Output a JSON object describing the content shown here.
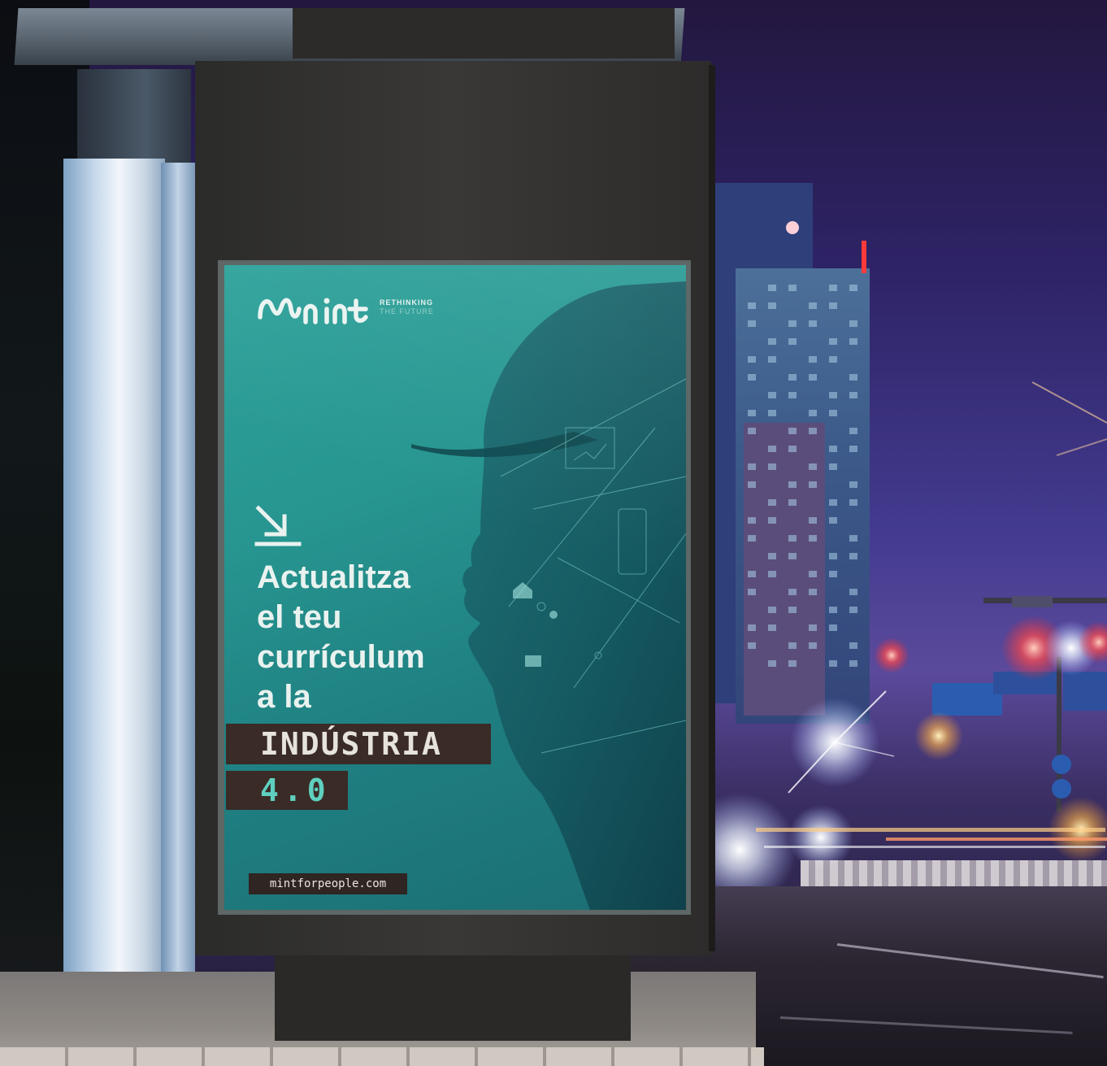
{
  "poster": {
    "logo_wordmark": "mint",
    "logo_tagline_line1": "RETHINKING",
    "logo_tagline_line2": "THE FUTURE",
    "headline_lines": [
      "Actualitza",
      "el teu",
      "currículum",
      "a la"
    ],
    "highlight_word": "INDÚSTRIA",
    "version": "4.0",
    "website": "mintforpeople.com"
  },
  "colors": {
    "poster_teal": "#279590",
    "tag_brown": "#3a2b27",
    "headline_text": "#e9f2ef",
    "version_text": "#5fd0c0",
    "night_sky": "#433b8f"
  },
  "icons": {
    "logo": "mint-logo-icon",
    "arrow": "arrow-down-right-icon"
  }
}
